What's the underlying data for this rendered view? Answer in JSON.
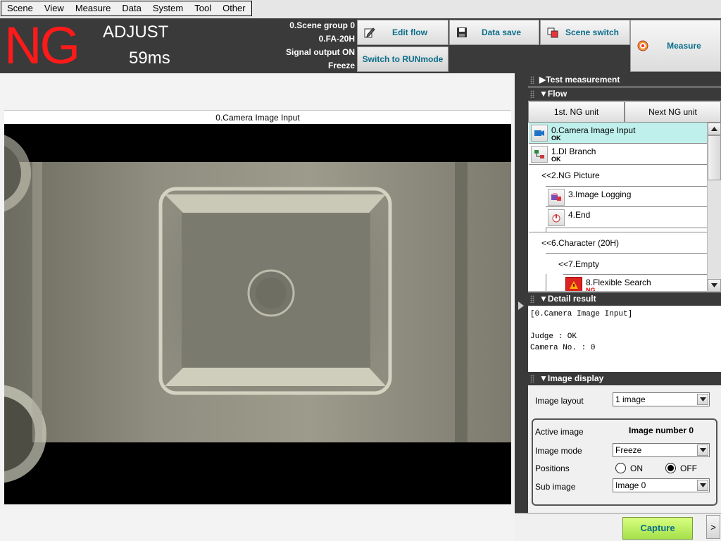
{
  "menu": [
    "Scene",
    "View",
    "Measure",
    "Data",
    "System",
    "Tool",
    "Other"
  ],
  "header": {
    "judge": "NG",
    "judge_color": "#ff1a1a",
    "mode": "ADJUST",
    "time": "59ms",
    "info": [
      "0.Scene group 0",
      "0.FA-20H",
      "Signal output ON",
      "Freeze"
    ],
    "buttons": {
      "edit_flow": "Edit flow",
      "run_mode": "Switch to RUNmode",
      "data_save": "Data save",
      "scene_switch": "Scene switch",
      "measure": "Measure"
    }
  },
  "image_panel": {
    "title": "0.Camera Image Input"
  },
  "panel": {
    "test_measurement": "▶Test measurement",
    "flow_header": "▼Flow",
    "first_ng": "1st. NG unit",
    "next_ng": "Next NG unit",
    "detail_header": "▼Detail result",
    "image_display_header": "▼Image display"
  },
  "flow": [
    {
      "name": "0.Camera Image Input",
      "result": "OK",
      "icon": "camera-icon"
    },
    {
      "name": "1.DI Branch",
      "result": "OK",
      "icon": "branch-icon"
    },
    {
      "name": "<<2.NG Picture",
      "result": ""
    },
    {
      "name": "3.Image Logging",
      "result": "",
      "icon": "image-logging-icon"
    },
    {
      "name": "4.End",
      "result": "",
      "icon": "end-icon"
    },
    {
      "name": "<<6.Character (20H)",
      "result": ""
    },
    {
      "name": "<<7.Empty",
      "result": ""
    },
    {
      "name": "8.Flexible Search",
      "result": "NG",
      "icon": "flexible-search-icon"
    }
  ],
  "detail": {
    "lines": [
      "[0.Camera Image Input]",
      "",
      "Judge : OK",
      "Camera No. : 0"
    ]
  },
  "image_display": {
    "layout_label": "Image layout",
    "layout_value": "1 image",
    "active_label": "Active image",
    "active_value": "Image number 0",
    "mode_label": "Image mode",
    "mode_value": "Freeze",
    "positions_label": "Positions",
    "on": "ON",
    "off": "OFF",
    "positions_selected": "OFF",
    "sub_label": "Sub image",
    "sub_value": "Image 0"
  },
  "bottom": {
    "capture": "Capture",
    "more": ">"
  }
}
